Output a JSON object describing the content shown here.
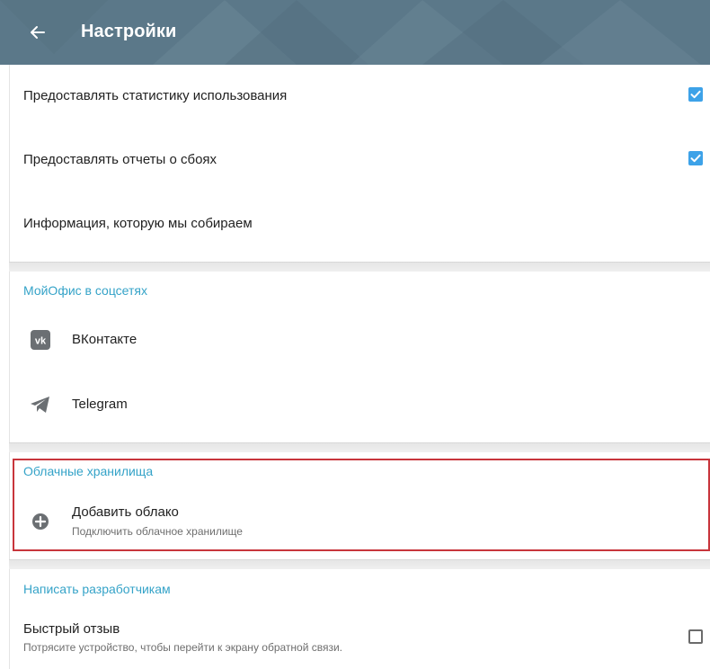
{
  "header": {
    "title": "Настройки",
    "back_icon": "arrow-left-icon",
    "color": "#5b7889"
  },
  "privacy": {
    "usage_stats_label": "Предоставлять статистику использования",
    "usage_stats_checked": true,
    "crash_reports_label": "Предоставлять отчеты о сбоях",
    "crash_reports_checked": true,
    "info_label": "Информация, которую мы собираем"
  },
  "social": {
    "section_title": "МойОфис в соцсетях",
    "vk_label": "ВКонтакте",
    "vk_icon": "vk-icon",
    "telegram_label": "Telegram",
    "telegram_icon": "telegram-icon"
  },
  "cloud": {
    "section_title": "Облачные хранилища",
    "add_label": "Добавить облако",
    "add_sublabel": "Подключить облачное хранилище",
    "add_icon": "plus-circle-icon"
  },
  "developers": {
    "section_title": "Написать разработчикам",
    "feedback_label": "Быстрый отзыв",
    "feedback_sublabel": "Потрясите устройство, чтобы перейти к экрану обратной связи.",
    "feedback_checked": false
  },
  "colors": {
    "accent": "#35a3c8",
    "checkbox": "#3da2e8",
    "highlight": "#c8353c"
  }
}
